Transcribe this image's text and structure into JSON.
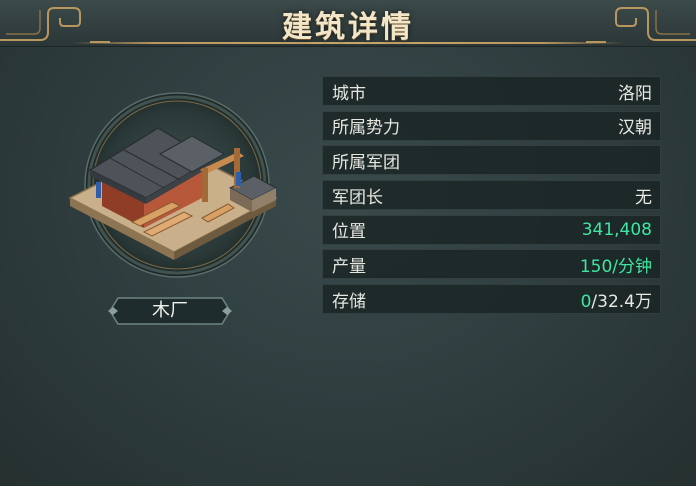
{
  "title": "建筑详情",
  "building": {
    "name": "木厂"
  },
  "details": [
    {
      "label": "城市",
      "value": "洛阳"
    },
    {
      "label": "所属势力",
      "value": "汉朝"
    },
    {
      "label": "所属军团",
      "value": ""
    },
    {
      "label": "军团长",
      "value": "无"
    },
    {
      "label": "位置",
      "value": "341,408"
    },
    {
      "label": "产量",
      "value": "150/分钟"
    },
    {
      "label": "存储",
      "value_current": "0",
      "value_rest": "/32.4万"
    }
  ],
  "colors": {
    "accent_green": "#3de7a2",
    "gold": "#c9a86c",
    "title": "#f3e6c8"
  },
  "icons": [
    "sawmill-building-icon"
  ]
}
